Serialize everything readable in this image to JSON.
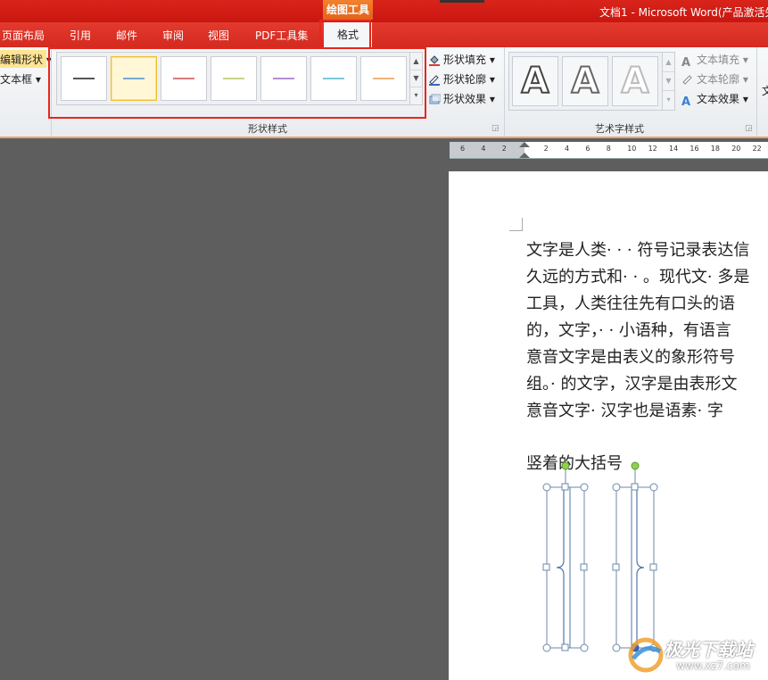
{
  "titlebar": {
    "context_group": "绘图工具",
    "title": "文档1 - Microsoft Word(产品激活失败)"
  },
  "tabs": [
    "页面布局",
    "引用",
    "邮件",
    "审阅",
    "视图",
    "PDF工具集"
  ],
  "active_tab": "格式",
  "ribbon": {
    "left_items": [
      "编辑形状",
      "文本框"
    ],
    "shape_styles_label": "形状样式",
    "shape_style_colors": [
      "#555555",
      "#7aa7d6",
      "#d97a7a",
      "#c8d48a",
      "#b48ed4",
      "#7cc8dc",
      "#f0b27a"
    ],
    "shape_commands": [
      "形状填充",
      "形状轮廓",
      "形状效果"
    ],
    "wordart_label": "艺术字样式",
    "wordart_letter": "A",
    "text_commands": [
      "文本填充",
      "文本轮廓",
      "文本效果"
    ],
    "overflow_text": "文"
  },
  "ruler": {
    "ticks": [
      "6",
      "4",
      "2",
      "",
      "2",
      "4",
      "6",
      "8",
      "10",
      "12",
      "14",
      "16",
      "18",
      "20",
      "22"
    ]
  },
  "document": {
    "lines": [
      "文字是人类· · · 符号记录表达信",
      "久远的方式和· · 。现代文· 多是",
      "工具，人类往往先有口头的语",
      "的，文字，· · 小语种，有语言",
      "意音文字是由表义的象形符号",
      "组。· 的文字，汉字是由表形文",
      "意音文字· 汉字也是语素· 字"
    ],
    "heading": "竖着的大括号"
  },
  "watermark": {
    "name": "极光下载站",
    "url": "www.xz7.com"
  }
}
